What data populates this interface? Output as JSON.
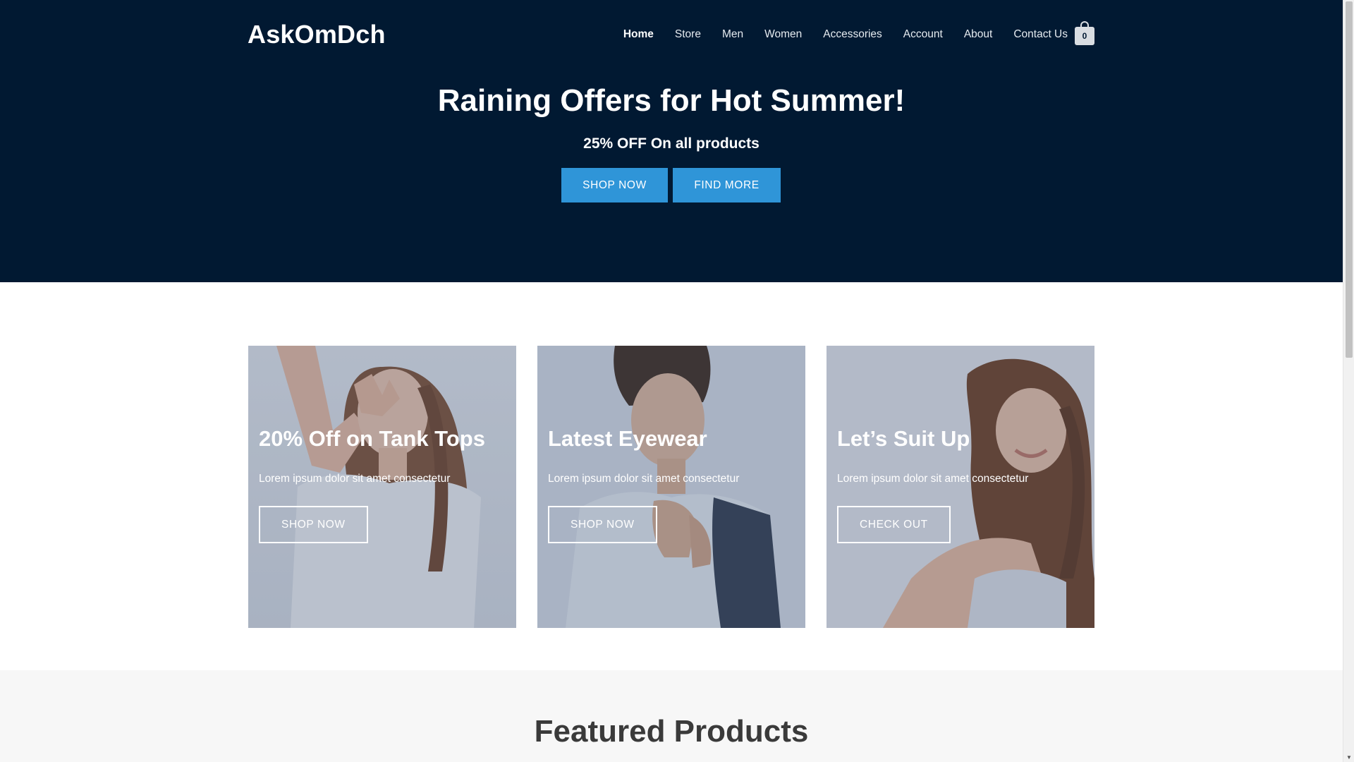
{
  "header": {
    "brand": "AskOmDch",
    "nav": [
      {
        "label": "Home",
        "active": true
      },
      {
        "label": "Store"
      },
      {
        "label": "Men"
      },
      {
        "label": "Women"
      },
      {
        "label": "Accessories"
      },
      {
        "label": "Account"
      },
      {
        "label": "About"
      },
      {
        "label": "Contact Us"
      }
    ],
    "cart_count": "0",
    "cart_icon": "shopping-bag-icon"
  },
  "hero": {
    "title": "Raining Offers for Hot Summer!",
    "subtitle": "25% OFF On all products",
    "primary_button": "SHOP NOW",
    "secondary_button": "FIND MORE"
  },
  "cards": [
    {
      "title": "20% Off on Tank Tops",
      "text": "Lorem ipsum dolor sit amet consectetur",
      "button": "SHOP NOW"
    },
    {
      "title": "Latest Eyewear",
      "text": "Lorem ipsum dolor sit amet consectetur",
      "button": "SHOP NOW"
    },
    {
      "title": "Let’s Suit Up",
      "text": "Lorem ipsum dolor sit amet consectetur",
      "button": "CHECK OUT"
    }
  ],
  "featured": {
    "title": "Featured Products"
  },
  "colors": {
    "hero_bg": "#011932",
    "accent": "#2f95d8",
    "featured_bg": "#f7f7f7"
  }
}
